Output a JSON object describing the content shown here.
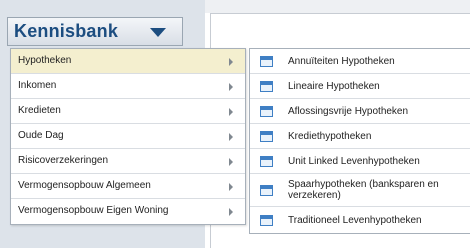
{
  "header": {
    "title": "Kennisbank"
  },
  "menu": {
    "items": [
      {
        "label": "Hypotheken"
      },
      {
        "label": "Inkomen"
      },
      {
        "label": "Kredieten"
      },
      {
        "label": "Oude Dag"
      },
      {
        "label": "Risicoverzekeringen"
      },
      {
        "label": "Vermogensopbouw Algemeen"
      },
      {
        "label": "Vermogensopbouw Eigen Woning"
      }
    ]
  },
  "submenu": {
    "items": [
      {
        "label": "Annuïteiten Hypotheken",
        "icon": "document-icon"
      },
      {
        "label": "Lineaire Hypotheken",
        "icon": "document-icon"
      },
      {
        "label": "Aflossingsvrije Hypotheken",
        "icon": "document-icon"
      },
      {
        "label": "Krediethypotheken",
        "icon": "document-icon"
      },
      {
        "label": "Unit Linked Levenhypotheken",
        "icon": "document-icon"
      },
      {
        "label": "Spaarhypotheken (banksparen en verzekeren)",
        "icon": "document-icon"
      },
      {
        "label": "Traditioneel Levenhypotheken",
        "icon": "document-icon"
      }
    ]
  },
  "colors": {
    "brand": "#1c4d80",
    "active_row": "#f4efcf",
    "icon_blue": "#3f7fc4"
  }
}
